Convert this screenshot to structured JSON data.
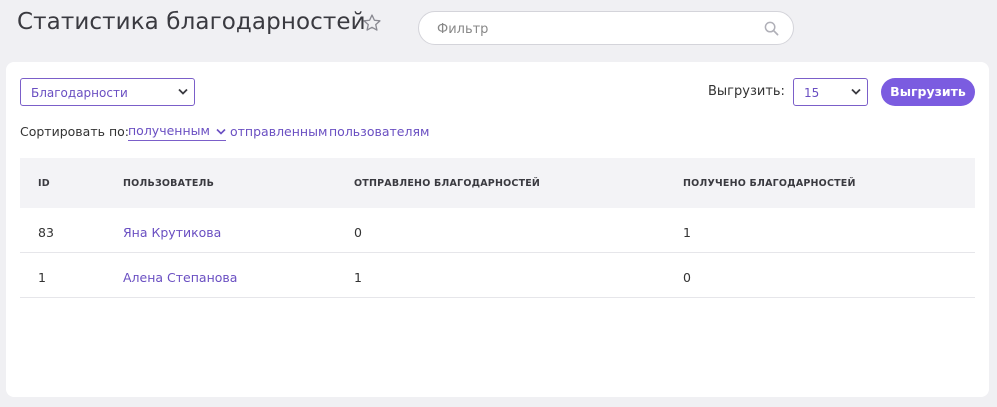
{
  "header": {
    "title": "Статистика благодарностей",
    "filter_placeholder": "Фильтр"
  },
  "toolbar": {
    "type_select_value": "Благодарности",
    "export_label": "Выгрузить:",
    "count_select_value": "15",
    "export_button_label": "Выгрузить"
  },
  "sort": {
    "label": "Сортировать по:",
    "active": "полученным",
    "options": [
      "отправленным",
      "пользователям"
    ]
  },
  "table": {
    "columns": [
      "ID",
      "ПОЛЬЗОВАТЕЛЬ",
      "ОТПРАВЛЕНО БЛАГОДАРНОСТЕЙ",
      "ПОЛУЧЕНО БЛАГОДАРНОСТЕЙ"
    ],
    "rows": [
      [
        "83",
        "Яна Крутикова",
        "0",
        "1"
      ],
      [
        "1",
        "Алена Степанова",
        "1",
        "0"
      ]
    ]
  },
  "colors": {
    "accent": "#7b5ce0",
    "link": "#6a4fc2",
    "background": "#f0f0f3"
  }
}
